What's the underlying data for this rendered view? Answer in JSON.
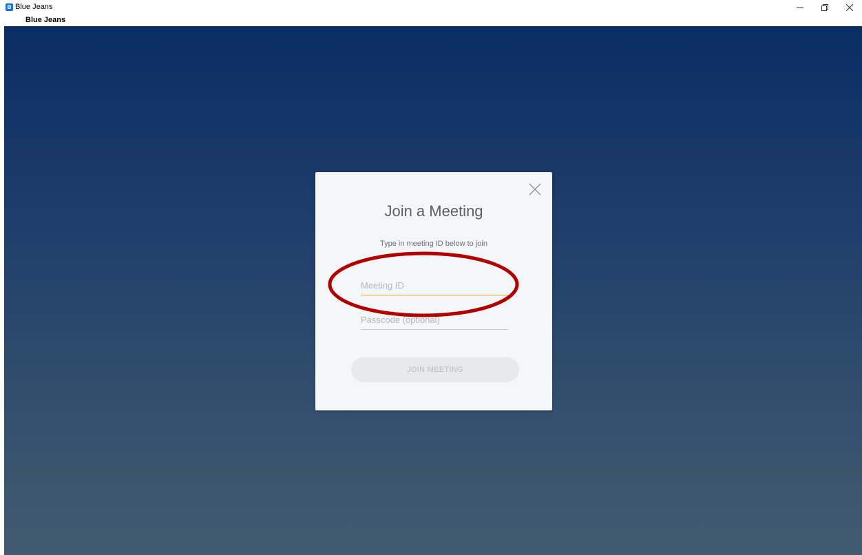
{
  "window": {
    "title": "Blue Jeans",
    "subtitle": "Blue Jeans",
    "app_icon_letter": "B",
    "controls": [
      "minimize-icon",
      "restore-icon",
      "close-icon"
    ]
  },
  "dialog": {
    "title": "Join a Meeting",
    "subtitle": "Type in meeting ID below to join",
    "meeting_id": {
      "value": "",
      "placeholder": "Meeting ID"
    },
    "passcode": {
      "value": "",
      "placeholder": "Passcode (optional)"
    },
    "join_label": "JOIN MEETING",
    "close_icon": "close-icon"
  },
  "colors": {
    "background_top": "#0a2d63",
    "background_bottom": "#435b70",
    "dialog_bg": "#f5f6f7",
    "focus_underline": "#f0a12b",
    "annotation": "#b00000",
    "app_icon": "#1a73d9"
  }
}
